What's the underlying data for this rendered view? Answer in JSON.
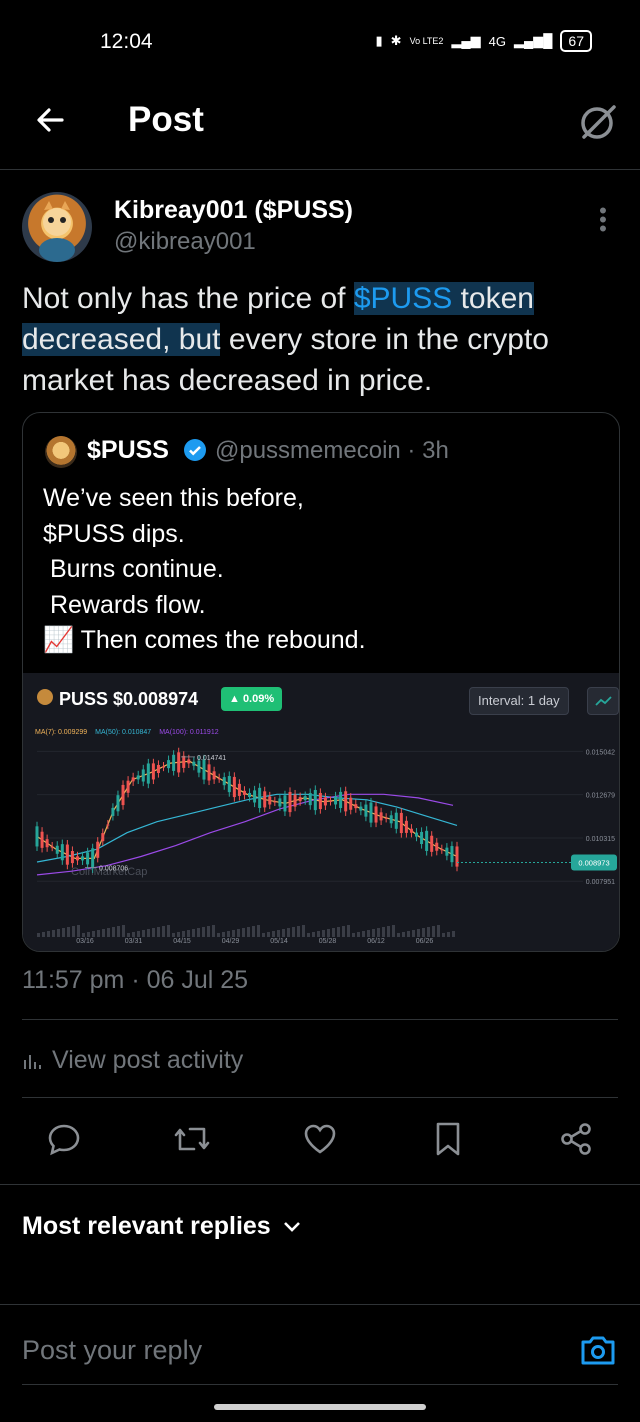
{
  "status_bar": {
    "time": "12:04",
    "network": "4G",
    "lte": "Vo LTE2",
    "battery": "67"
  },
  "header": {
    "title": "Post"
  },
  "post": {
    "display_name": "Kibreay001 ($PUSS)",
    "handle": "@kibreay001",
    "text_part1": "Not only has the price of ",
    "cashtag": "$PUSS",
    "text_part2": " token",
    "text_part3": "decreased, but",
    "text_part4": " every store in the crypto market has decreased in price.",
    "timestamp": "11:57 pm · 06 Jul 25"
  },
  "quote": {
    "name": "$PUSS",
    "handle_time": "@pussmemecoin · 3h",
    "text": "We’ve seen this before,\n$PUSS dips.\n Burns continue.\n Rewards flow.\n📈 Then comes the rebound."
  },
  "chart_panel": {
    "title": "PUSS $0.008974",
    "change": "▲ 0.09%",
    "interval": "Interval: 1 day",
    "ma7": "MA(7): 0.009299",
    "ma50": "MA(50): 0.010847",
    "ma100": "MA(100): 0.011912",
    "watermark": "CoinMarketCap",
    "high_label": "0.014741",
    "low_label": "0.008706",
    "current_label": "0.008973",
    "colors": {
      "ma7": "#f0b35a",
      "ma50": "#35b6d4",
      "ma100": "#9b4ae8",
      "up": "#26a69a",
      "down": "#ef5350"
    }
  },
  "chart_data": {
    "type": "line",
    "title": "PUSS $0.008974",
    "x_ticks": [
      "03/16",
      "03/31",
      "04/15",
      "04/29",
      "05/14",
      "05/28",
      "06/12",
      "06/26"
    ],
    "y_ticks": [
      "0.015042",
      "0.012679",
      "0.010315",
      "0.007951"
    ],
    "ylim": [
      0.0072,
      0.0155
    ],
    "series": [
      {
        "name": "MA(7)",
        "values": [
          0.0104,
          0.0097,
          0.0092,
          0.0092,
          0.0118,
          0.0135,
          0.0139,
          0.0144,
          0.0145,
          0.0139,
          0.0133,
          0.0127,
          0.0124,
          0.0122,
          0.0125,
          0.0123,
          0.0124,
          0.0119,
          0.0115,
          0.0112,
          0.0104,
          0.0098,
          0.0093
        ]
      },
      {
        "name": "MA(50)",
        "values": [
          0.009,
          0.0093,
          0.0097,
          0.0106,
          0.0112,
          0.0116,
          0.012,
          0.0124,
          0.0127,
          0.0127,
          0.0125,
          0.0124,
          0.012,
          0.0115,
          0.011
        ]
      },
      {
        "name": "MA(100)",
        "values": [
          0.0083,
          0.0085,
          0.0088,
          0.0093,
          0.0099,
          0.0106,
          0.0112,
          0.0119,
          0.0124,
          0.0127,
          0.0127,
          0.0125,
          0.0121
        ]
      }
    ]
  },
  "activity": {
    "label": "View post activity"
  },
  "replies": {
    "label": "Most relevant replies"
  },
  "composer": {
    "placeholder": "Post your reply"
  }
}
